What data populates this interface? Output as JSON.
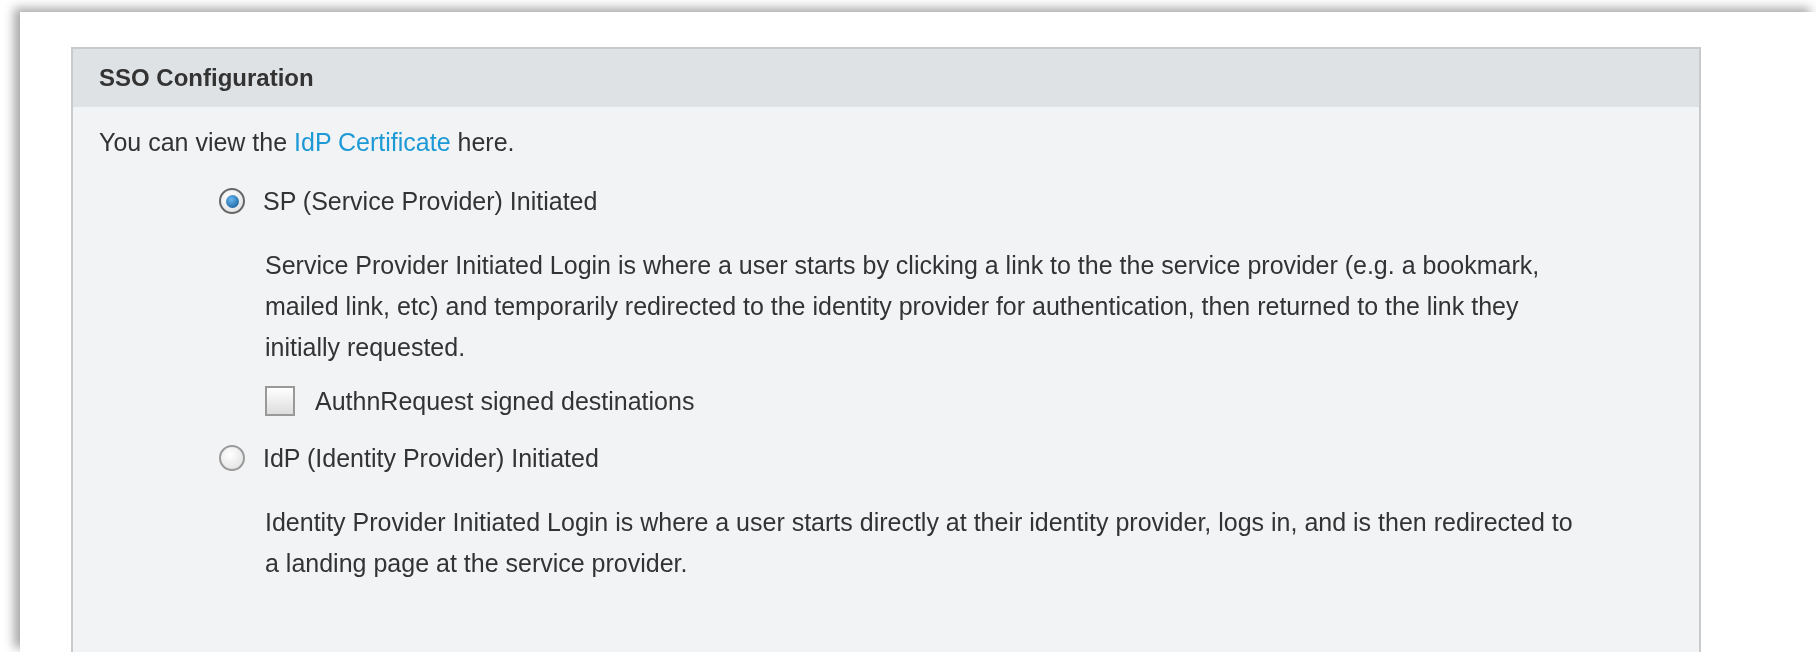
{
  "panel": {
    "title": "SSO Configuration",
    "intro": {
      "before": "You can view the",
      "link": "IdP Certificate",
      "after": "here."
    },
    "options": [
      {
        "label": "SP (Service Provider) Initiated",
        "selected": true,
        "description": "Service Provider Initiated Login is where a user starts by clicking a link to the the service provider (e.g. a bookmark, mailed link, etc) and temporarily redirected to the identity provider for authentication, then returned to the link they initially requested.",
        "checkbox": {
          "label": "AuthnRequest signed destinations",
          "checked": false
        }
      },
      {
        "label": "IdP (Identity Provider) Initiated",
        "selected": false,
        "description": "Identity Provider Initiated Login is where a user starts directly at their identity provider, logs in, and is then redirected to a landing page at the service provider."
      }
    ]
  }
}
